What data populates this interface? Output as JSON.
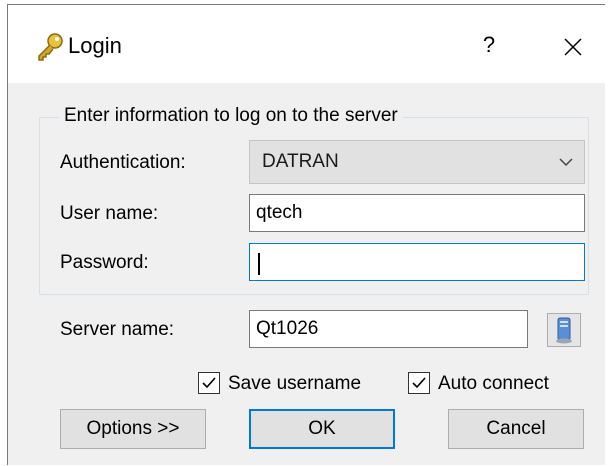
{
  "window": {
    "title": "Login",
    "help_label": "?",
    "close_label": "✕",
    "title_icon": "key-icon"
  },
  "group": {
    "legend": "Enter information to log on to the server"
  },
  "fields": {
    "authentication_label": "Authentication:",
    "authentication_value": "DATRAN",
    "username_label": "User name:",
    "username_value": "qtech",
    "password_label": "Password:",
    "password_value": "",
    "server_label": "Server name:",
    "server_value": "Qt1026",
    "server_browse_icon": "server-icon"
  },
  "options": {
    "save_username_label": "Save username",
    "save_username_checked": true,
    "auto_connect_label": "Auto connect",
    "auto_connect_checked": true
  },
  "buttons": {
    "options_label": "Options >>",
    "ok_label": "OK",
    "cancel_label": "Cancel"
  },
  "colors": {
    "focus": "#0078d7",
    "dialog_bg": "#f0f0f0"
  }
}
